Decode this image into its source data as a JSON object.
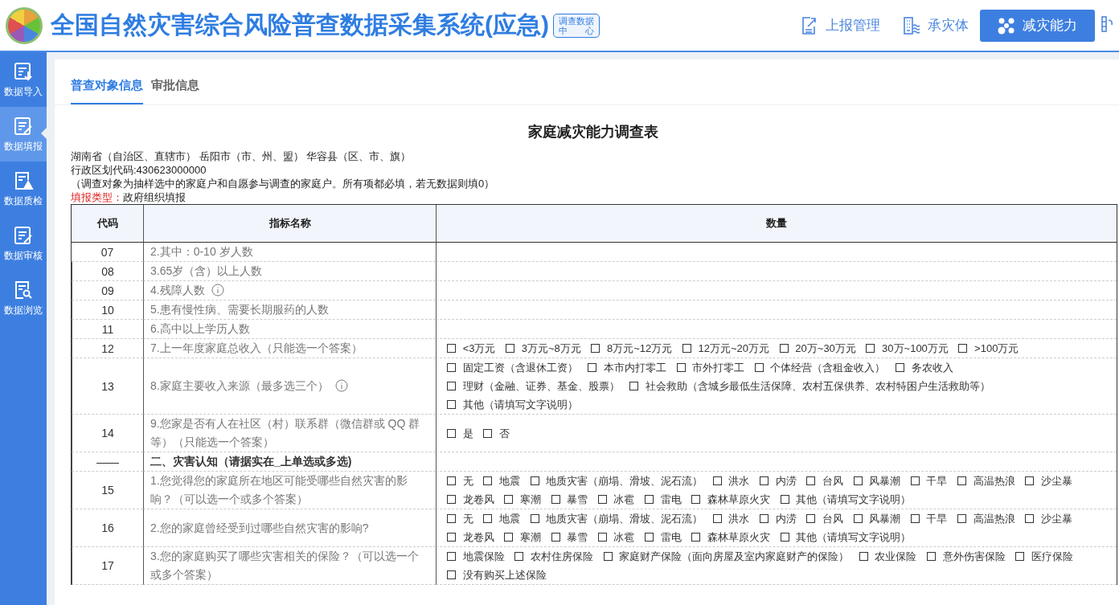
{
  "header": {
    "title": "全国自然灾害综合风险普查数据采集系统(应急)",
    "badge_lines": [
      "调查数据",
      "中 心"
    ],
    "nav": [
      {
        "label": "上报管理",
        "kind": "report",
        "selected": false
      },
      {
        "label": "承灾体",
        "kind": "building",
        "selected": false
      },
      {
        "label": "减灾能力",
        "kind": "nodes",
        "selected": true
      }
    ]
  },
  "sidebar": {
    "items": [
      {
        "label": "数据导入",
        "kind": "import",
        "selected": false
      },
      {
        "label": "数据填报",
        "kind": "edit",
        "selected": true
      },
      {
        "label": "数据质检",
        "kind": "warning",
        "selected": false
      },
      {
        "label": "数据审核",
        "kind": "edit",
        "selected": false
      },
      {
        "label": "数据浏览",
        "kind": "search",
        "selected": false
      }
    ]
  },
  "tabs": [
    {
      "label": "普查对象信息",
      "selected": true
    },
    {
      "label": "审批信息",
      "selected": false
    }
  ],
  "form": {
    "title": "家庭减灾能力调查表",
    "region_line": "湖南省（自治区、直辖市） 岳阳市（市、州、盟） 华容县（区、市、旗）",
    "code_line": "行政区划代码:430623000000",
    "note": "（调查对象为抽样选中的家庭户和自愿参与调查的家庭户。所有项都必填，若无数据则填0）",
    "fill_type_label": "填报类型：",
    "fill_type_value": "政府组织填报",
    "columns": [
      "代码",
      "指标名称",
      "数量"
    ],
    "rows": [
      {
        "kind": "number",
        "code": "07",
        "name": "2.其中：0-10 岁人数",
        "info": false
      },
      {
        "kind": "number",
        "code": "08",
        "name": "3.65岁（含）以上人数",
        "info": false
      },
      {
        "kind": "number",
        "code": "09",
        "name": "4.残障人数",
        "info": true
      },
      {
        "kind": "number",
        "code": "10",
        "name": "5.患有慢性病、需要长期服药的人数",
        "info": false
      },
      {
        "kind": "number",
        "code": "11",
        "name": "6.高中以上学历人数",
        "info": false
      },
      {
        "kind": "choice",
        "code": "12",
        "name": "7.上一年度家庭总收入（只能选一个答案）",
        "info": false,
        "options": [
          {
            "label": "<3万元",
            "checked": false
          },
          {
            "label": "3万元~8万元",
            "checked": false
          },
          {
            "label": "8万元~12万元",
            "checked": false
          },
          {
            "label": "12万元~20万元",
            "checked": false
          },
          {
            "label": "20万~30万元",
            "checked": false
          },
          {
            "label": "30万~100万元",
            "checked": false
          },
          {
            "label": ">100万元",
            "checked": false
          }
        ]
      },
      {
        "kind": "choice",
        "code": "13",
        "name": "8.家庭主要收入来源（最多选三个）",
        "info": true,
        "options": [
          {
            "label": "固定工资（含退休工资）",
            "checked": false
          },
          {
            "label": "本市内打零工",
            "checked": false
          },
          {
            "label": "市外打零工",
            "checked": false
          },
          {
            "label": "个体经营（含租金收入）",
            "checked": false
          },
          {
            "label": "务农收入",
            "checked": false
          },
          {
            "label": "理财（金融、证券、基金、股票）",
            "checked": false
          },
          {
            "label": "社会救助（含城乡最低生活保障、农村五保供养、农村特困户生活救助等）",
            "checked": false
          },
          {
            "label": "其他（请填写文字说明）",
            "checked": false
          }
        ]
      },
      {
        "kind": "choice",
        "code": "14",
        "name": "9.您家是否有人在社区（村）联系群（微信群或 QQ 群等）（只能选一个答案）",
        "info": false,
        "options": [
          {
            "label": "是",
            "checked": false
          },
          {
            "label": "否",
            "checked": false
          }
        ]
      },
      {
        "kind": "section",
        "code": "——",
        "name": "二、灾害认知（请据实在_上单选或多选)",
        "info": false
      },
      {
        "kind": "choice",
        "code": "15",
        "name": "1.您觉得您的家庭所在地区可能受哪些自然灾害的影响？（可以选一个或多个答案）",
        "info": false,
        "options": [
          {
            "label": "无",
            "checked": false
          },
          {
            "label": "地震",
            "checked": false
          },
          {
            "label": "地质灾害（崩塌、滑坡、泥石流）",
            "checked": false
          },
          {
            "label": "洪水",
            "checked": false
          },
          {
            "label": "内涝",
            "checked": false
          },
          {
            "label": "台风",
            "checked": false
          },
          {
            "label": "风暴潮",
            "checked": false
          },
          {
            "label": "干旱",
            "checked": false
          },
          {
            "label": "高温热浪",
            "checked": false
          },
          {
            "label": "沙尘暴",
            "checked": false
          },
          {
            "label": "龙卷风",
            "checked": false
          },
          {
            "label": "寒潮",
            "checked": false
          },
          {
            "label": "暴雪",
            "checked": false
          },
          {
            "label": "冰雹",
            "checked": false
          },
          {
            "label": "雷电",
            "checked": false
          },
          {
            "label": "森林草原火灾",
            "checked": false
          },
          {
            "label": "其他（请填写文字说明）",
            "checked": false
          }
        ]
      },
      {
        "kind": "choice",
        "code": "16",
        "name": "2.您的家庭曾经受到过哪些自然灾害的影响?",
        "info": false,
        "options": [
          {
            "label": "无",
            "checked": false
          },
          {
            "label": "地震",
            "checked": false
          },
          {
            "label": "地质灾害（崩塌、滑坡、泥石流）",
            "checked": false
          },
          {
            "label": "洪水",
            "checked": false
          },
          {
            "label": "内涝",
            "checked": false
          },
          {
            "label": "台风",
            "checked": false
          },
          {
            "label": "风暴潮",
            "checked": false
          },
          {
            "label": "干旱",
            "checked": false
          },
          {
            "label": "高温热浪",
            "checked": false
          },
          {
            "label": "沙尘暴",
            "checked": false
          },
          {
            "label": "龙卷风",
            "checked": false
          },
          {
            "label": "寒潮",
            "checked": false
          },
          {
            "label": "暴雪",
            "checked": false
          },
          {
            "label": "冰雹",
            "checked": false
          },
          {
            "label": "雷电",
            "checked": false
          },
          {
            "label": "森林草原火灾",
            "checked": false
          },
          {
            "label": "其他（请填写文字说明）",
            "checked": false
          }
        ]
      },
      {
        "kind": "choice",
        "code": "17",
        "name": "3.您的家庭购买了哪些灾害相关的保险？（可以选一个或多个答案）",
        "info": false,
        "options": [
          {
            "label": "地震保险",
            "checked": false
          },
          {
            "label": "农村住房保险",
            "checked": false
          },
          {
            "label": "家庭财产保险（面向房屋及室内家庭财产的保险）",
            "checked": false
          },
          {
            "label": "农业保险",
            "checked": false
          },
          {
            "label": "意外伤害保险",
            "checked": false
          },
          {
            "label": "医疗保险",
            "checked": false
          },
          {
            "label": "没有购买上述保险",
            "checked": false
          }
        ]
      }
    ]
  }
}
